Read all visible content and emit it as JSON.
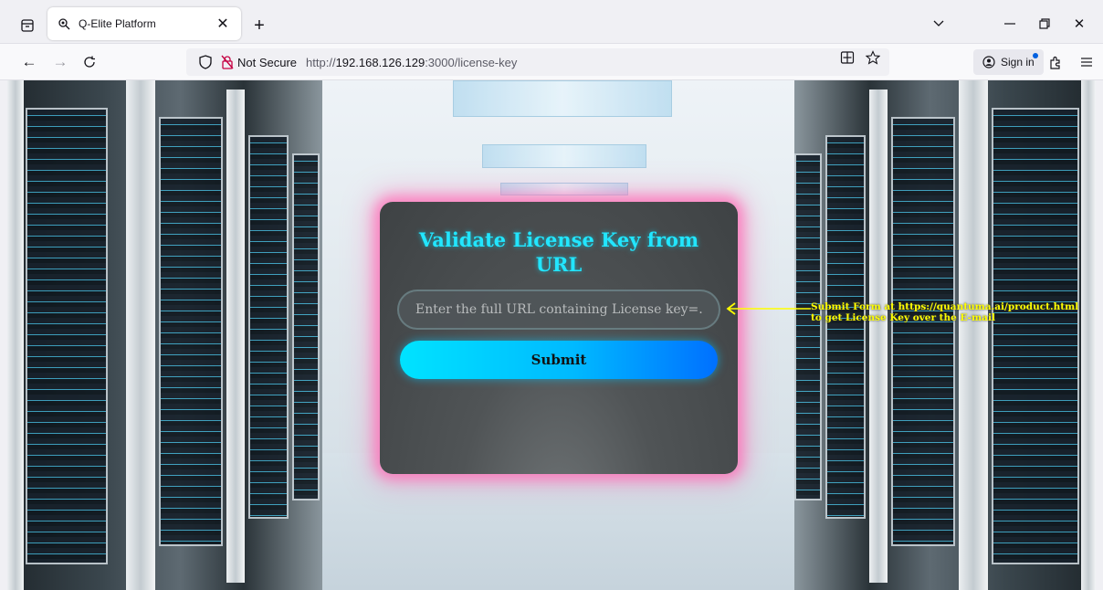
{
  "browser": {
    "tab_title": "Q-Elite Platform",
    "security_label": "Not Secure",
    "url_prefix": "http://",
    "url_host": "192.168.126.129",
    "url_path": ":3000/license-key",
    "sign_in_label": "Sign in"
  },
  "card": {
    "title": "Validate License Key from URL",
    "input_placeholder": "Enter the full URL containing License key=...",
    "input_value": "",
    "submit_label": "Submit"
  },
  "annotation": {
    "line1": "Submit Form at https://quantuma.ai/product.html",
    "line2": "to get License Key over the E-mail"
  },
  "colors": {
    "title_cyan": "#22e6ff",
    "card_glow": "#ff69b4",
    "annotation_yellow": "#ffff00"
  }
}
